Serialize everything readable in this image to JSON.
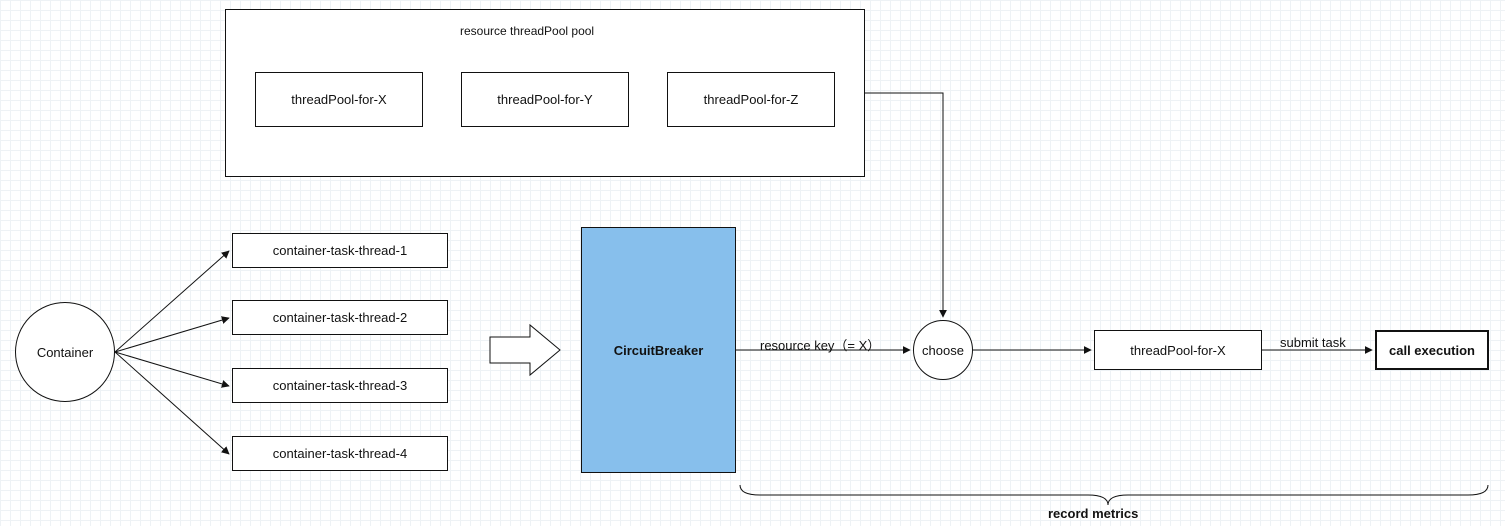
{
  "container": {
    "label": "Container"
  },
  "taskThreads": {
    "t1": "container-task-thread-1",
    "t2": "container-task-thread-2",
    "t3": "container-task-thread-3",
    "t4": "container-task-thread-4"
  },
  "circuitBreaker": {
    "label": "CircuitBreaker"
  },
  "resourceKeyLabel": "resource key（= X）",
  "choose": {
    "label": "choose"
  },
  "selectedPool": {
    "label": "threadPool-for-X"
  },
  "submitTaskLabel": "submit task",
  "callExecution": {
    "label": "call execution"
  },
  "recordMetricsLabel": "record metrics",
  "poolGroup": {
    "title": "resource threadPool pool",
    "x": "threadPool-for-X",
    "y": "threadPool-for-Y",
    "z": "threadPool-for-Z"
  },
  "colors": {
    "blue": "#87bfec",
    "stroke": "#111111"
  },
  "chart_data": {
    "type": "flow",
    "nodes": [
      {
        "id": "container",
        "label": "Container",
        "shape": "circle"
      },
      {
        "id": "taskthread1",
        "label": "container-task-thread-1",
        "shape": "rect"
      },
      {
        "id": "taskthread2",
        "label": "container-task-thread-2",
        "shape": "rect"
      },
      {
        "id": "taskthread3",
        "label": "container-task-thread-3",
        "shape": "rect"
      },
      {
        "id": "taskthread4",
        "label": "container-task-thread-4",
        "shape": "rect"
      },
      {
        "id": "circuitbreaker",
        "label": "CircuitBreaker",
        "shape": "rect",
        "highlight": true
      },
      {
        "id": "choose",
        "label": "choose",
        "shape": "circle"
      },
      {
        "id": "poolgroup",
        "label": "resource threadPool pool",
        "shape": "group",
        "children": [
          "pool_x",
          "pool_y",
          "pool_z"
        ]
      },
      {
        "id": "pool_x",
        "label": "threadPool-for-X",
        "shape": "rect"
      },
      {
        "id": "pool_y",
        "label": "threadPool-for-Y",
        "shape": "rect"
      },
      {
        "id": "pool_z",
        "label": "threadPool-for-Z",
        "shape": "rect"
      },
      {
        "id": "selectedpool",
        "label": "threadPool-for-X",
        "shape": "rect"
      },
      {
        "id": "callexec",
        "label": "call execution",
        "shape": "rect",
        "bold": true
      }
    ],
    "edges": [
      {
        "from": "container",
        "to": "taskthread1"
      },
      {
        "from": "container",
        "to": "taskthread2"
      },
      {
        "from": "container",
        "to": "taskthread3"
      },
      {
        "from": "container",
        "to": "taskthread4"
      },
      {
        "from": "taskthreads",
        "to": "circuitbreaker",
        "style": "block-arrow"
      },
      {
        "from": "circuitbreaker",
        "to": "choose",
        "label": "resource key（= X）"
      },
      {
        "from": "poolgroup",
        "to": "choose"
      },
      {
        "from": "choose",
        "to": "selectedpool"
      },
      {
        "from": "selectedpool",
        "to": "callexec",
        "label": "submit task"
      }
    ],
    "annotations": [
      {
        "type": "brace",
        "span": [
          "circuitbreaker",
          "callexec"
        ],
        "label": "record metrics"
      }
    ]
  }
}
